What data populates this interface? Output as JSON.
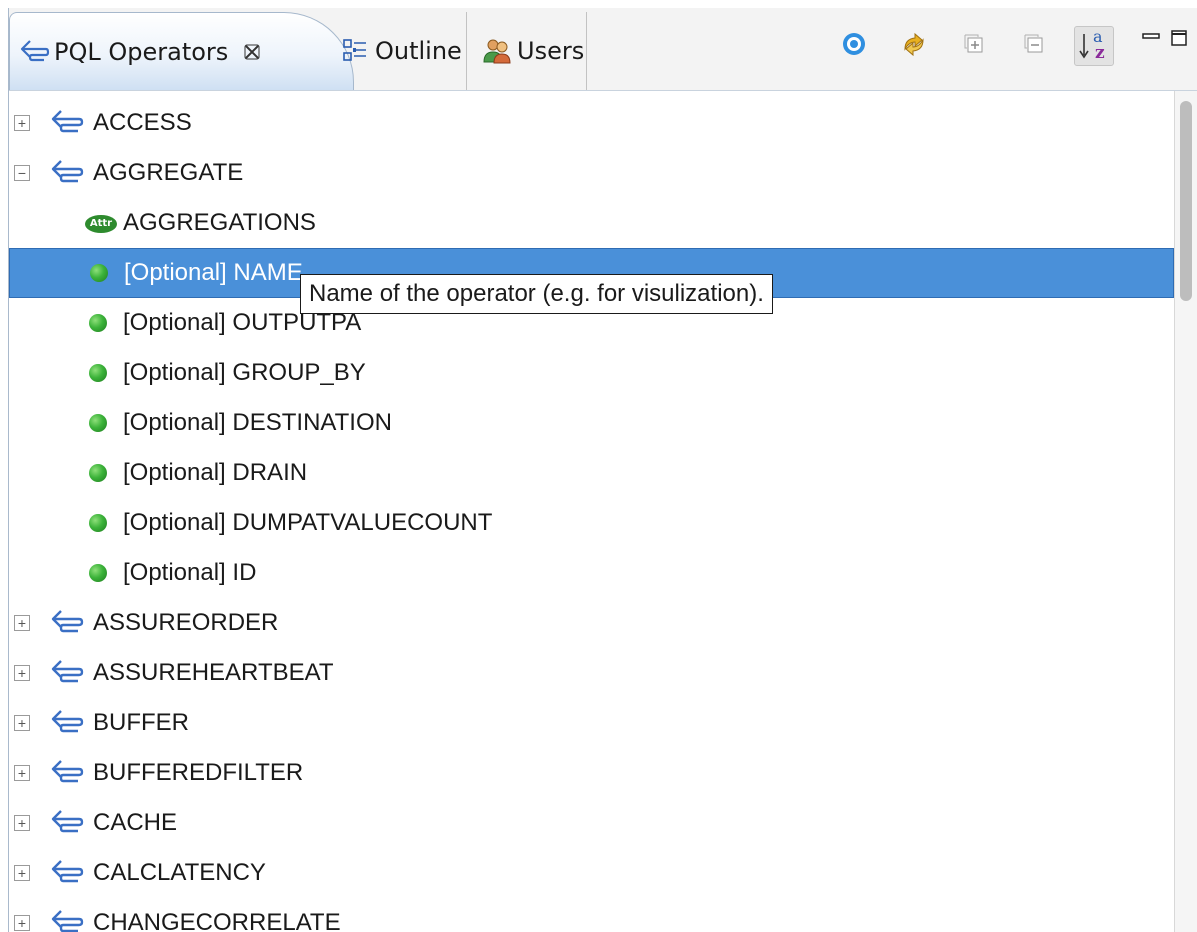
{
  "tabs": [
    {
      "label": "PQL Operators",
      "icon": "operator-icon",
      "active": true,
      "closable": true
    },
    {
      "label": "Outline",
      "icon": "outline-icon",
      "active": false
    },
    {
      "label": "Users",
      "icon": "users-icon",
      "active": false
    }
  ],
  "toolbar": {
    "buttons": [
      {
        "name": "focus-icon"
      },
      {
        "name": "link-sync-icon"
      },
      {
        "name": "expand-all-icon"
      },
      {
        "name": "collapse-all-icon"
      },
      {
        "name": "sort-alphabetically-icon",
        "pressed": true
      }
    ],
    "sort_glyph_top": "a",
    "sort_glyph_bottom": "z"
  },
  "tree": {
    "rows": [
      {
        "type": "operator",
        "label": "ACCESS",
        "expanded": false
      },
      {
        "type": "operator",
        "label": "AGGREGATE",
        "expanded": true
      },
      {
        "type": "attribute",
        "label": "AGGREGATIONS"
      },
      {
        "type": "parameter",
        "label": "[Optional] NAME",
        "selected": true
      },
      {
        "type": "parameter",
        "label": "[Optional] OUTPUTPA"
      },
      {
        "type": "parameter",
        "label": "[Optional] GROUP_BY"
      },
      {
        "type": "parameter",
        "label": "[Optional] DESTINATION"
      },
      {
        "type": "parameter",
        "label": "[Optional] DRAIN"
      },
      {
        "type": "parameter",
        "label": "[Optional] DUMPATVALUECOUNT"
      },
      {
        "type": "parameter",
        "label": "[Optional] ID"
      },
      {
        "type": "operator",
        "label": "ASSUREORDER",
        "expanded": false
      },
      {
        "type": "operator",
        "label": "ASSUREHEARTBEAT",
        "expanded": false
      },
      {
        "type": "operator",
        "label": "BUFFER",
        "expanded": false
      },
      {
        "type": "operator",
        "label": "BUFFEREDFILTER",
        "expanded": false
      },
      {
        "type": "operator",
        "label": "CACHE",
        "expanded": false
      },
      {
        "type": "operator",
        "label": "CALCLATENCY",
        "expanded": false
      },
      {
        "type": "operator",
        "label": "CHANGECORRELATE",
        "expanded": false
      }
    ]
  },
  "tooltip": {
    "text": "Name of the operator (e.g. for visulization)."
  },
  "attr_badge": "Attr",
  "colors": {
    "selection": "#4a90d9",
    "operator_icon": "#3a6fc4",
    "parameter_dot": "#3cb33a",
    "attr_badge": "#2e8b2e"
  }
}
